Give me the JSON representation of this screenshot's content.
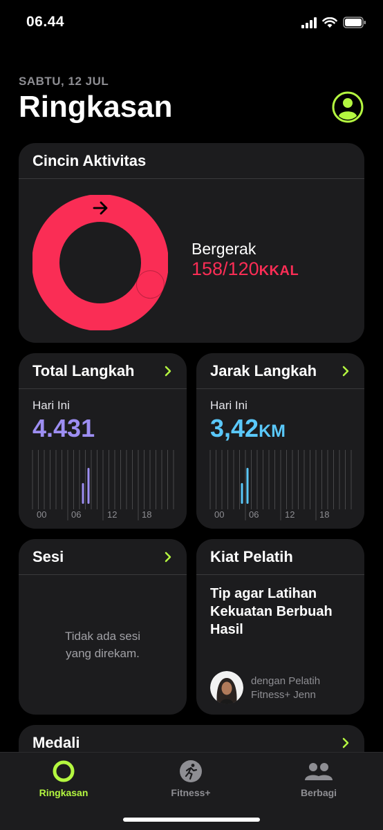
{
  "status": {
    "time": "06.44"
  },
  "header": {
    "date": "SABTU, 12 JUL",
    "title": "Ringkasan"
  },
  "activity_ring": {
    "title": "Cincin Aktivitas",
    "metric_label": "Bergerak",
    "value": "158/120",
    "unit": "KKAL",
    "progress": 1.32,
    "color": "#fa2d55"
  },
  "steps": {
    "title": "Total Langkah",
    "period": "Hari Ini",
    "value": "4.431",
    "color": "#9d8ef2",
    "axis": [
      "00",
      "06",
      "12",
      "18"
    ]
  },
  "distance": {
    "title": "Jarak Langkah",
    "period": "Hari Ini",
    "value": "3,42",
    "unit": "KM",
    "color": "#5ac8fa",
    "axis": [
      "00",
      "06",
      "12",
      "18"
    ]
  },
  "sessions": {
    "title": "Sesi",
    "empty_line1": "Tidak ada sesi",
    "empty_line2": "yang direkam."
  },
  "coach": {
    "title": "Kiat Pelatih",
    "tip": "Tip agar Latihan Kekuatan Berbuah Hasil",
    "by_line1": "dengan Pelatih",
    "by_line2": "Fitness+ Jenn"
  },
  "medals": {
    "title": "Medali"
  },
  "tabs": [
    {
      "label": "Ringkasan",
      "active": true
    },
    {
      "label": "Fitness+",
      "active": false
    },
    {
      "label": "Berbagi",
      "active": false
    }
  ],
  "colors": {
    "accent": "#b4f740",
    "inactive": "#8e8e93"
  }
}
